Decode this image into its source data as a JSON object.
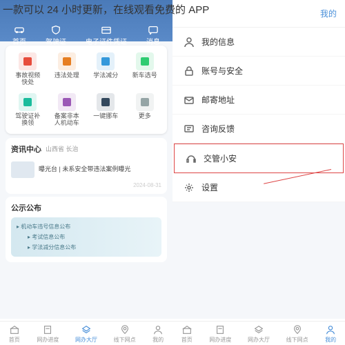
{
  "page_title": "一款可以 24 小时更新，在线观看免费的 APP",
  "left": {
    "top_tabs": [
      {
        "label": "首页",
        "icon": "car"
      },
      {
        "label": "驾驶证",
        "icon": "shield"
      },
      {
        "label": "电子证件凭证",
        "icon": "card"
      },
      {
        "label": "消息",
        "icon": "chat"
      }
    ],
    "grid": [
      {
        "label": "事故视频\n快处",
        "icon": "siren",
        "color": "#e74c3c"
      },
      {
        "label": "违法处理",
        "icon": "doc",
        "color": "#e67e22"
      },
      {
        "label": "学法减分",
        "icon": "book",
        "color": "#3498db"
      },
      {
        "label": "新车选号",
        "icon": "plate",
        "color": "#2ecc71"
      },
      {
        "label": "驾驶证补\n换领",
        "icon": "idcard",
        "color": "#1abc9c"
      },
      {
        "label": "备案非本\n人机动车",
        "icon": "car2",
        "color": "#9b59b6"
      },
      {
        "label": "一键挪车",
        "icon": "move",
        "color": "#34495e"
      },
      {
        "label": "更多",
        "icon": "more",
        "color": "#95a5a6"
      }
    ],
    "news": {
      "title": "资讯中心",
      "location": "山西省 长治",
      "items": [
        {
          "text": "曝光台 | 未系安全带违法案例曝光",
          "date": "2024-08-31"
        }
      ]
    },
    "notice": {
      "title": "公示公布",
      "items": [
        "机动车违号信息公布",
        "考试信息公布",
        "学法减分信息公布"
      ]
    },
    "bottom_nav": [
      "首页",
      "网办进度",
      "网办大厅",
      "线下网点",
      "我的"
    ]
  },
  "right": {
    "header_title": "我的",
    "menu": [
      {
        "label": "我的信息",
        "icon": "user"
      },
      {
        "label": "账号与安全",
        "icon": "lock"
      },
      {
        "label": "邮寄地址",
        "icon": "mail"
      },
      {
        "label": "咨询反馈",
        "icon": "feedback"
      },
      {
        "label": "交管小安",
        "icon": "headset",
        "highlighted": true
      },
      {
        "label": "设置",
        "icon": "gear"
      }
    ],
    "bottom_nav": [
      "首页",
      "网办进度",
      "网办大厅",
      "线下网点",
      "我的"
    ]
  }
}
